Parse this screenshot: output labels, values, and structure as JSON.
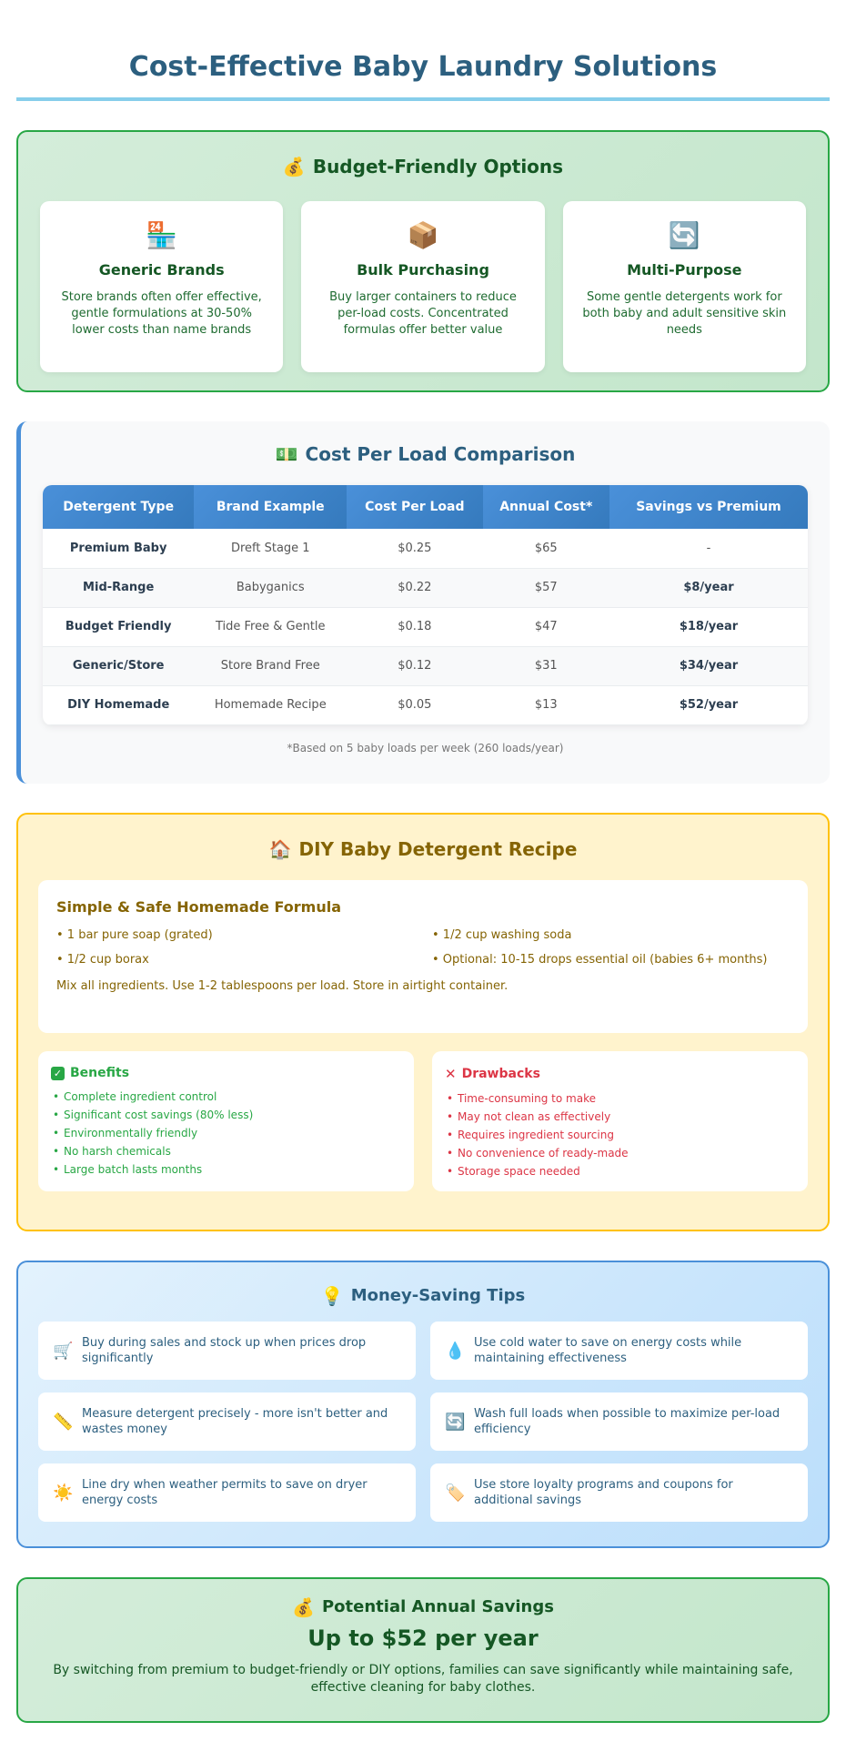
{
  "page_title": "Cost-Effective Baby Laundry Solutions",
  "budget": {
    "icon": "money-bag-icon",
    "title": "Budget-Friendly Options",
    "cards": [
      {
        "icon": "store-icon",
        "glyph": "🏪",
        "title": "Generic Brands",
        "text": "Store brands often offer effective, gentle formulations at 30-50% lower costs than name brands"
      },
      {
        "icon": "package-icon",
        "glyph": "📦",
        "title": "Bulk Purchasing",
        "text": "Buy larger containers to reduce per-load costs. Concentrated formulas offer better value"
      },
      {
        "icon": "recycle-icon",
        "glyph": "🔄",
        "title": "Multi-Purpose",
        "text": "Some gentle detergents work for both baby and adult sensitive skin needs"
      }
    ]
  },
  "comparison": {
    "icon": "dollar-bill-icon",
    "title": "Cost Per Load Comparison",
    "headers": [
      "Detergent Type",
      "Brand Example",
      "Cost Per Load",
      "Annual Cost*",
      "Savings vs Premium"
    ],
    "rows": [
      [
        "Premium Baby",
        "Dreft Stage 1",
        "$0.25",
        "$65",
        "-"
      ],
      [
        "Mid-Range",
        "Babyganics",
        "$0.22",
        "$57",
        "$8/year"
      ],
      [
        "Budget Friendly",
        "Tide Free & Gentle",
        "$0.18",
        "$47",
        "$18/year"
      ],
      [
        "Generic/Store",
        "Store Brand Free",
        "$0.12",
        "$31",
        "$34/year"
      ],
      [
        "DIY Homemade",
        "Homemade Recipe",
        "$0.05",
        "$13",
        "$52/year"
      ]
    ],
    "footnote": "*Based on 5 baby loads per week (260 loads/year)"
  },
  "diy": {
    "icon": "house-icon",
    "title": "DIY Baby Detergent Recipe",
    "recipe_title": "Simple & Safe Homemade Formula",
    "ingredients": [
      "• 1 bar pure soap (grated)",
      "• 1/2 cup washing soda",
      "• 1/2 cup borax",
      "• Optional: 10-15 drops essential oil (babies 6+ months)"
    ],
    "instructions": "Mix all ingredients. Use 1-2 tablespoons per load. Store in airtight container.",
    "benefits_title": "Benefits",
    "benefits": [
      "Complete ingredient control",
      "Significant cost savings (80% less)",
      "Environmentally friendly",
      "No harsh chemicals",
      "Large batch lasts months"
    ],
    "drawbacks_title": "Drawbacks",
    "drawbacks": [
      "Time-consuming to make",
      "May not clean as effectively",
      "Requires ingredient sourcing",
      "No convenience of ready-made",
      "Storage space needed"
    ]
  },
  "tips": {
    "icon": "lightbulb-icon",
    "title": "Money-Saving Tips",
    "items": [
      {
        "icon": "cart-icon",
        "glyph": "🛒",
        "text": "Buy during sales and stock up when prices drop significantly"
      },
      {
        "icon": "droplet-icon",
        "glyph": "💧",
        "text": "Use cold water to save on energy costs while maintaining effectiveness"
      },
      {
        "icon": "ruler-icon",
        "glyph": "📏",
        "text": "Measure detergent precisely - more isn't better and wastes money"
      },
      {
        "icon": "recycle-icon",
        "glyph": "🔄",
        "text": "Wash full loads when possible to maximize per-load efficiency"
      },
      {
        "icon": "sun-icon",
        "glyph": "☀️",
        "text": "Line dry when weather permits to save on dryer energy costs"
      },
      {
        "icon": "tag-icon",
        "glyph": "🏷️",
        "text": "Use store loyalty programs and coupons for additional savings"
      }
    ]
  },
  "savings": {
    "icon": "money-bag-icon",
    "title": "Potential Annual Savings",
    "amount": "Up to $52 per year",
    "description": "By switching from premium to budget-friendly or DIY options, families can save significantly while maintaining safe, effective cleaning for baby clothes."
  }
}
